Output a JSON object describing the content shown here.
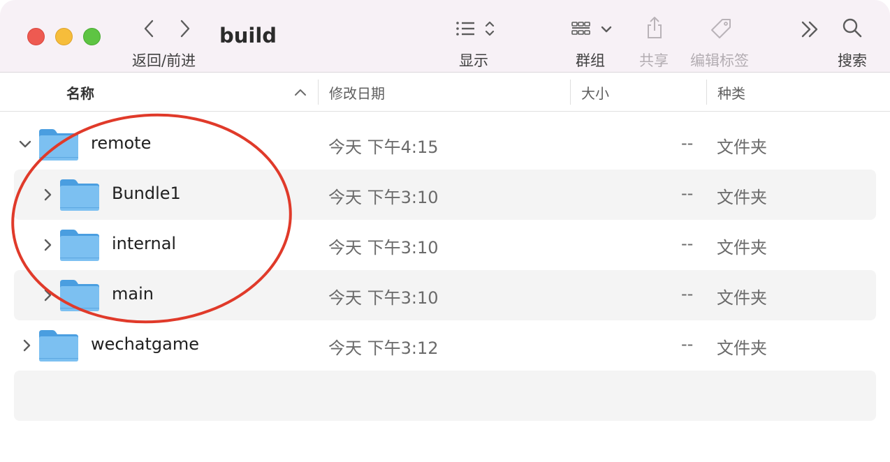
{
  "window": {
    "title": "build",
    "toolbar": {
      "back_icon": "chevron-left-icon",
      "forward_icon": "chevron-right-icon",
      "nav_label": "返回/前进",
      "view_icon": "list-view-icon",
      "view_label": "显示",
      "group_icon": "group-grid-icon",
      "group_label": "群组",
      "share_icon": "share-icon",
      "share_label": "共享",
      "tags_icon": "tag-icon",
      "tags_label": "编辑标签",
      "more_icon": "double-chevron-right-icon",
      "search_icon": "search-icon",
      "search_label": "搜索"
    }
  },
  "columns": {
    "name": "名称",
    "modified": "修改日期",
    "size": "大小",
    "kind": "种类"
  },
  "rows": [
    {
      "name": "remote",
      "date": "今天 下午4:15",
      "size": "--",
      "kind": "文件夹",
      "expanded": true,
      "level": 0
    },
    {
      "name": "Bundle1",
      "date": "今天 下午3:10",
      "size": "--",
      "kind": "文件夹",
      "expanded": false,
      "level": 1
    },
    {
      "name": "internal",
      "date": "今天 下午3:10",
      "size": "--",
      "kind": "文件夹",
      "expanded": false,
      "level": 1
    },
    {
      "name": "main",
      "date": "今天 下午3:10",
      "size": "--",
      "kind": "文件夹",
      "expanded": false,
      "level": 1
    },
    {
      "name": "wechatgame",
      "date": "今天 下午3:12",
      "size": "--",
      "kind": "文件夹",
      "expanded": false,
      "level": 0
    }
  ],
  "colors": {
    "annotation": "#e03a2a",
    "folder": "#6fb6ec",
    "toolbar_bg": "#f7f1f6"
  }
}
